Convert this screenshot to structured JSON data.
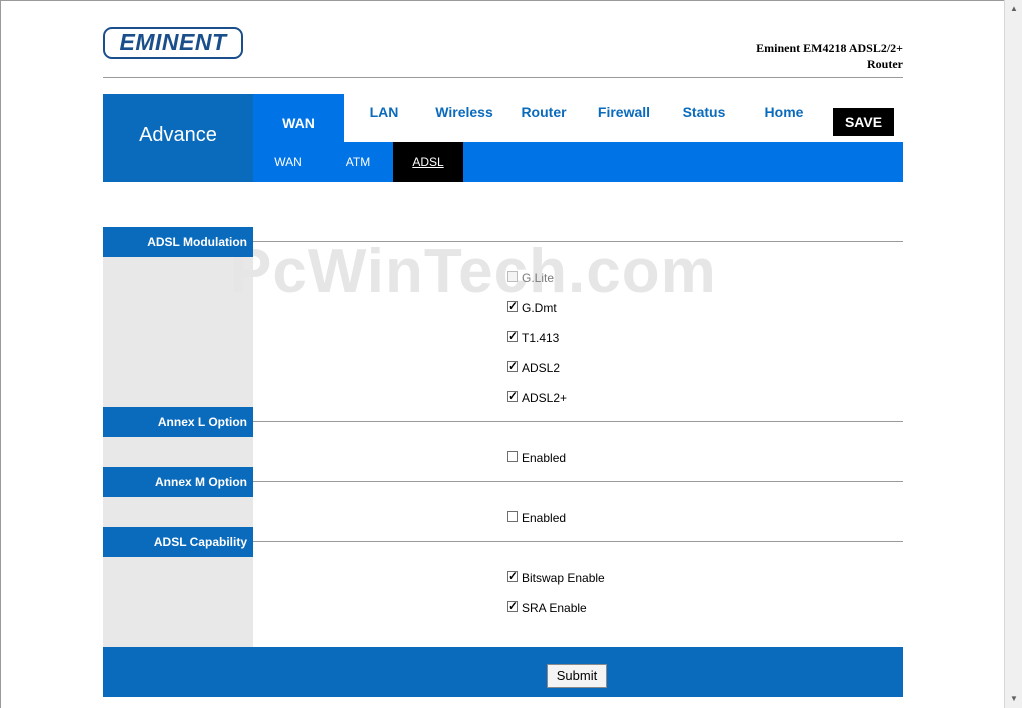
{
  "header": {
    "logo_text": "EMINENT",
    "model_line1": "Eminent EM4218 ADSL2/2+",
    "model_line2": "Router"
  },
  "nav": {
    "section_title": "Advance",
    "tabs": [
      {
        "label": "WAN",
        "active": true
      },
      {
        "label": "LAN"
      },
      {
        "label": "Wireless"
      },
      {
        "label": "Router"
      },
      {
        "label": "Firewall"
      },
      {
        "label": "Status"
      },
      {
        "label": "Home"
      }
    ],
    "save_label": "SAVE",
    "subtabs": [
      {
        "label": "WAN"
      },
      {
        "label": "ATM"
      },
      {
        "label": "ADSL",
        "active": true
      }
    ]
  },
  "watermark": "PcWinTech.com",
  "sections": {
    "modulation": {
      "title": "ADSL Modulation",
      "options": [
        {
          "label": "G.Lite",
          "checked": false,
          "disabled": true
        },
        {
          "label": "G.Dmt",
          "checked": true
        },
        {
          "label": "T1.413",
          "checked": true
        },
        {
          "label": "ADSL2",
          "checked": true
        },
        {
          "label": "ADSL2+",
          "checked": true
        }
      ]
    },
    "annex_l": {
      "title": "Annex L Option",
      "options": [
        {
          "label": "Enabled",
          "checked": false
        }
      ]
    },
    "annex_m": {
      "title": "Annex M Option",
      "options": [
        {
          "label": "Enabled",
          "checked": false
        }
      ]
    },
    "capability": {
      "title": "ADSL Capability",
      "options": [
        {
          "label": "Bitswap Enable",
          "checked": true
        },
        {
          "label": "SRA Enable",
          "checked": true
        }
      ]
    }
  },
  "footer": {
    "submit_label": "Submit"
  },
  "colors": {
    "brand_blue": "#0a6bbd",
    "tab_blue": "#0073e6",
    "save_black": "#000000"
  }
}
